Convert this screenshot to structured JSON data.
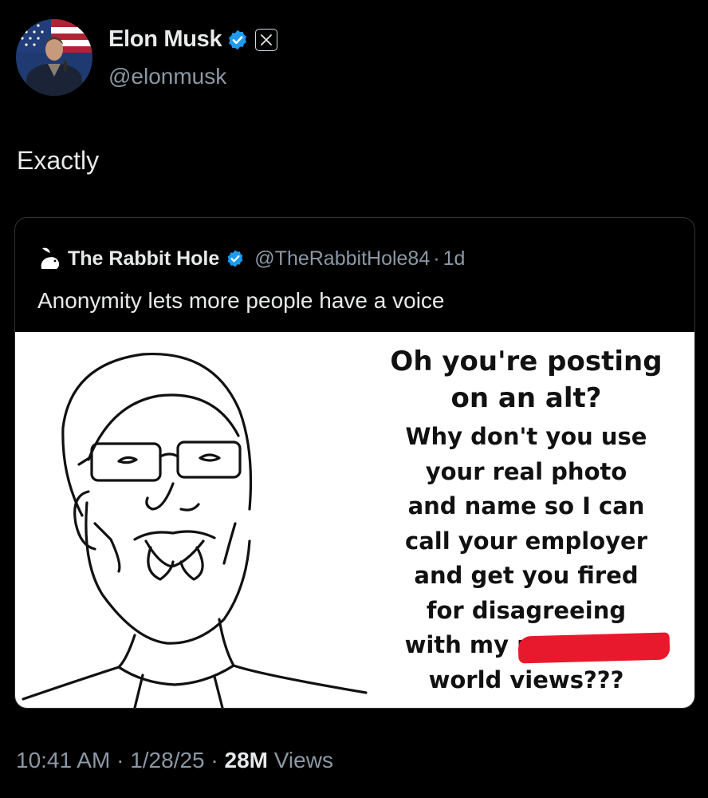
{
  "colors": {
    "background": "#000000",
    "text": "#e7e9ea",
    "muted": "#8b98a5",
    "verified": "#1d9bf0",
    "redaction": "#e8192c"
  },
  "author": {
    "display_name": "Elon Musk",
    "handle": "@elonmusk",
    "verified_icon": "verified-badge-icon",
    "affiliation_icon": "x-logo-icon"
  },
  "tweet": {
    "text": "Exactly"
  },
  "quoted": {
    "display_name": "The Rabbit Hole",
    "handle": "@TheRabbitHole84",
    "separator": "·",
    "age": "1d",
    "text": "Anonymity lets more people have a voice",
    "meme": {
      "title_lines": [
        "Oh you're posting",
        "on an alt?"
      ],
      "body_lines": [
        "Why don't you use",
        "your real photo",
        "and name so I can",
        "call your employer",
        "and get you fired",
        "for disagreeing"
      ],
      "redacted_line_prefix": "with my r",
      "last_line": "world views???"
    }
  },
  "meta": {
    "time": "10:41 AM",
    "sep1": " · ",
    "date": "1/28/25",
    "sep2": " · ",
    "views_count": "28M",
    "views_label": " Views"
  }
}
